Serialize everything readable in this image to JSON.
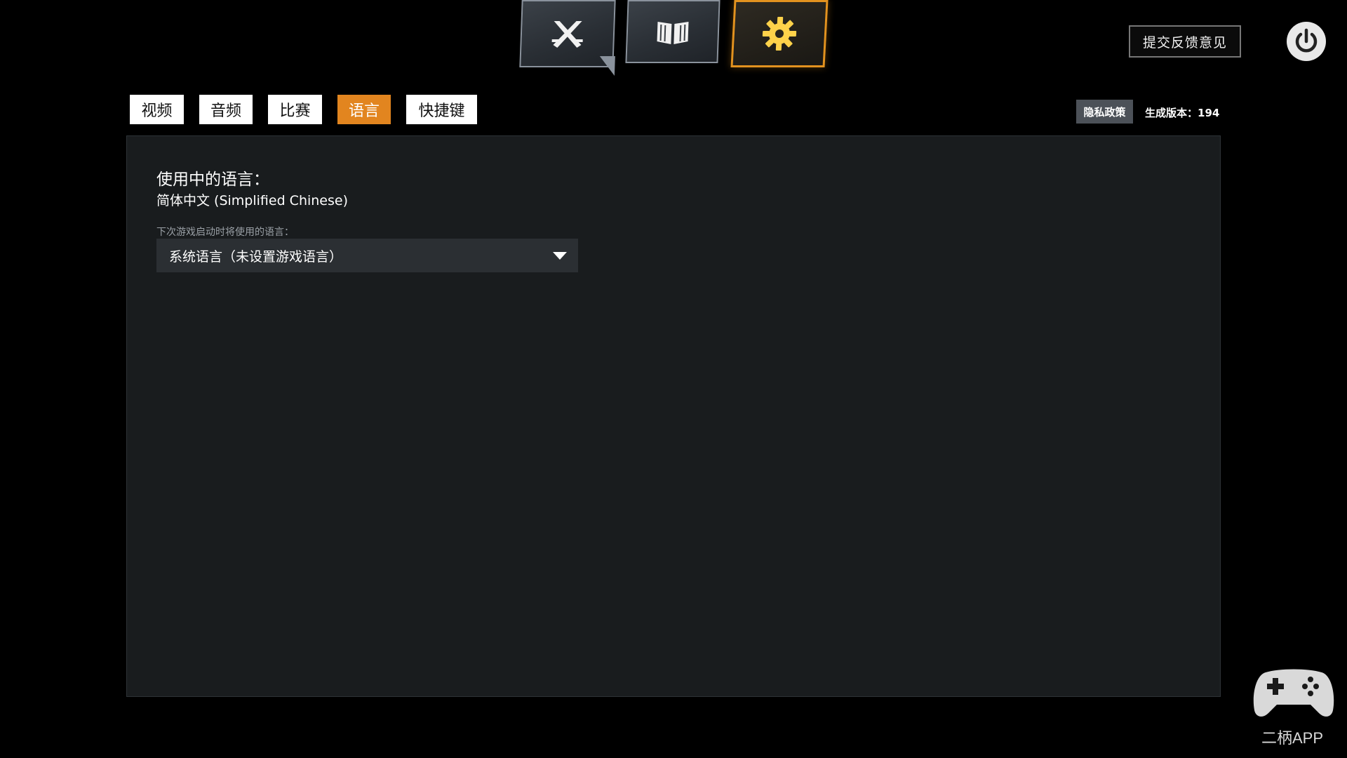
{
  "top_nav": {
    "tiles": [
      {
        "icon": "crossed-swords-icon"
      },
      {
        "icon": "open-book-icon"
      },
      {
        "icon": "gear-icon",
        "active": true
      }
    ]
  },
  "header": {
    "feedback_label": "提交反馈意见",
    "power_icon": "power-icon"
  },
  "tabs": [
    {
      "label": "视频",
      "active": false
    },
    {
      "label": "音频",
      "active": false
    },
    {
      "label": "比赛",
      "active": false
    },
    {
      "label": "语言",
      "active": true
    },
    {
      "label": "快捷键",
      "active": false
    }
  ],
  "meta": {
    "privacy_label": "隐私政策",
    "version_label": "生成版本：194"
  },
  "language": {
    "current_label": "使用中的语言：",
    "current_value": "简体中文 (Simplified Chinese)",
    "next_label": "下次游戏启动时将使用的语言：",
    "next_selected": "系统语言（未设置游戏语言）"
  },
  "colors": {
    "accent": "#e2851f",
    "panel": "#191c1e",
    "dropdown": "#2b2f33"
  },
  "watermark": {
    "text": "二柄APP",
    "icon": "gamepad-icon"
  }
}
